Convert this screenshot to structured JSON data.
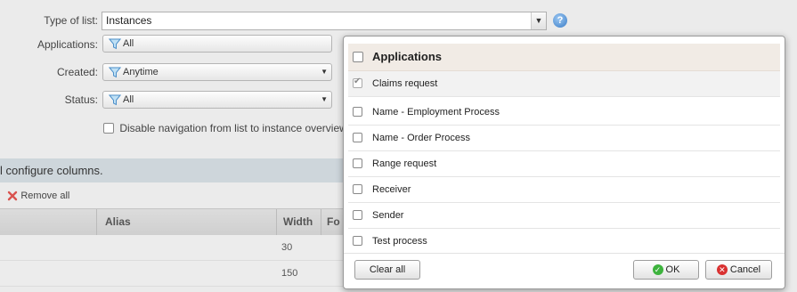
{
  "form": {
    "type_of_list": {
      "label": "Type of list:",
      "value": "Instances"
    },
    "applications": {
      "label": "Applications:",
      "value": "All"
    },
    "created": {
      "label": "Created:",
      "value": "Anytime"
    },
    "status": {
      "label": "Status:",
      "value": "All"
    },
    "disable_navigation": {
      "label": "Disable navigation from list to instance overview",
      "checked": false
    },
    "help_icon": "?"
  },
  "columns_section": {
    "text": "l configure columns.",
    "remove_all_label": "Remove all",
    "headers": [
      "Alias",
      "Width",
      "Fo"
    ],
    "rows": [
      {
        "width": "30"
      },
      {
        "width": "150"
      }
    ]
  },
  "popup": {
    "header": "Applications",
    "items": [
      {
        "label": "Claims request",
        "checked": true
      },
      {
        "label": "Name - Employment Process",
        "checked": false
      },
      {
        "label": "Name - Order Process",
        "checked": false
      },
      {
        "label": "Range request",
        "checked": false
      },
      {
        "label": "Receiver",
        "checked": false
      },
      {
        "label": "Sender",
        "checked": false
      },
      {
        "label": "Test process",
        "checked": false
      }
    ],
    "clear_all_label": "Clear all",
    "ok_label": "OK",
    "cancel_label": "Cancel"
  },
  "colors": {
    "ok": "#3db33d",
    "cancel": "#d93030",
    "help": "#3a7cc7",
    "band": "#ced6db"
  }
}
